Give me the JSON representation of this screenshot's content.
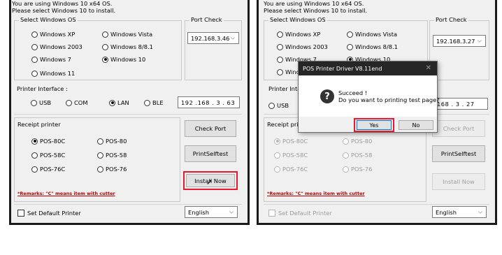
{
  "panels": [
    {
      "header": {
        "line1": "You are using Windows 10 x64 OS.",
        "line2": "Please select Windows 10 to install."
      },
      "os_group": {
        "title": "Select Windows OS",
        "options": [
          "Windows XP",
          "Windows Vista",
          "Windows 2003",
          "Windows 8/8.1",
          "Windows 7",
          "Windows 10",
          "Windows 11"
        ],
        "selected": "Windows 10"
      },
      "port_check": {
        "title": "Port Check",
        "value": "192.168.3.46"
      },
      "printer_interface": {
        "label": "Printer Interface :",
        "options": [
          "USB",
          "COM",
          "LAN",
          "BLE"
        ],
        "selected": "LAN",
        "ip": "192 .168 . 3 . 63"
      },
      "receipt": {
        "title": "Receipt printer",
        "options": [
          "POS-80C",
          "POS-80",
          "POS-58C",
          "POS-58",
          "POS-76C",
          "POS-76"
        ],
        "selected": "POS-80C"
      },
      "buttons": {
        "check_port": "Check Port",
        "self_test": "PrintSelftest",
        "install": "Install Now"
      },
      "remarks": "*Remarks: \"C\" means item with cutter",
      "default_printer": "Set Default Printer",
      "language": "English"
    },
    {
      "header": {
        "line1": "You are using Windows 10 x64 OS.",
        "line2": "Please select Windows 10 to install."
      },
      "os_group": {
        "title": "Select Windows OS",
        "options": [
          "Windows XP",
          "Windows Vista",
          "Windows 2003",
          "Windows 8/8.1",
          "Windows 7",
          "Windows 10",
          "Windows"
        ],
        "selected": "Windows 10"
      },
      "port_check": {
        "title": "Port Check",
        "value": "192.168.3.27"
      },
      "printer_interface": {
        "label": "Printer Interfa",
        "usb": "USB",
        "ip": "168 . 3 . 27"
      },
      "receipt": {
        "title": "Receipt printer",
        "options": [
          "POS-80C",
          "POS-80",
          "POS-58C",
          "POS-58",
          "POS-76C",
          "POS-76"
        ],
        "selected": "POS-80C"
      },
      "buttons": {
        "check_port": "Check Port",
        "self_test": "PrintSelftest",
        "install": "Install Now"
      },
      "remarks": "*Remarks: \"C\" means item with cutter",
      "default_printer": "Set Default Printer",
      "language": "English"
    }
  ],
  "dialog": {
    "title": "POS Printer Driver V8.11end",
    "close": "✕",
    "icon": "?",
    "line1": "Succeed !",
    "line2": "Do you want to printing test page?",
    "yes": "Yes",
    "no": "No"
  },
  "colors": {
    "highlight": "#e8182d",
    "remarks": "#b30000",
    "dialog_title_bg": "#262626"
  }
}
